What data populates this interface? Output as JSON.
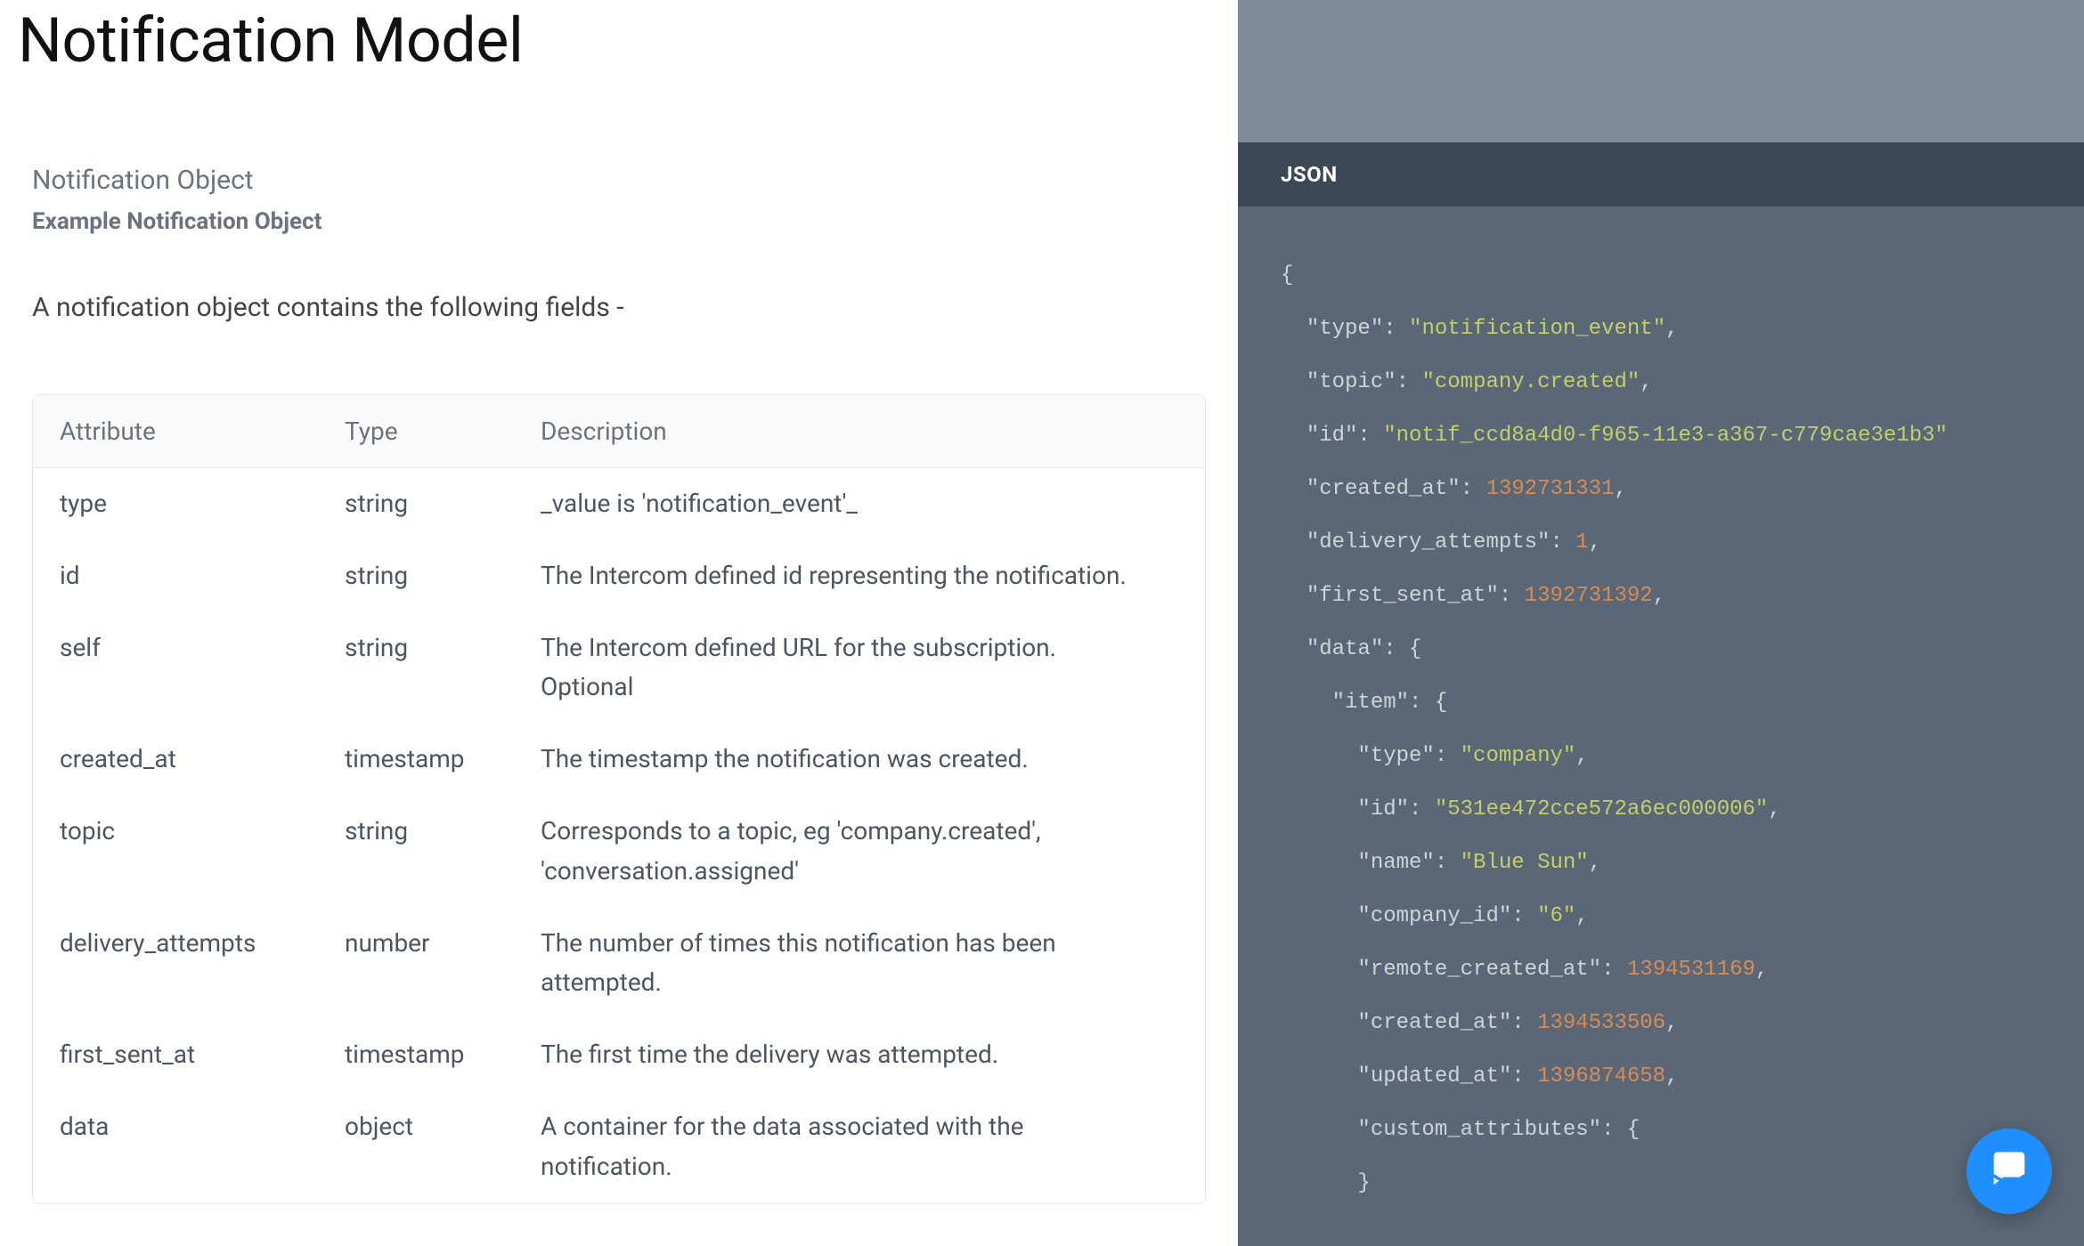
{
  "page": {
    "title": "Notification Model"
  },
  "section": {
    "heading": "Notification Object",
    "subheading": "Example Notification Object",
    "intro": "A notification object contains the following fields -"
  },
  "table": {
    "headers": {
      "attr": "Attribute",
      "type": "Type",
      "desc": "Description"
    },
    "rows": [
      {
        "attr": "type",
        "type": "string",
        "desc": "_value is 'notification_event'_"
      },
      {
        "attr": "id",
        "type": "string",
        "desc": "The Intercom defined id representing the notification."
      },
      {
        "attr": "self",
        "type": "string",
        "desc": "The Intercom defined URL for the subscription. Optional"
      },
      {
        "attr": "created_at",
        "type": "timestamp",
        "desc": "The timestamp the notification was created."
      },
      {
        "attr": "topic",
        "type": "string",
        "desc": "Corresponds to a topic, eg 'company.created', 'conversation.assigned'"
      },
      {
        "attr": "delivery_attempts",
        "type": "number",
        "desc": "The number of times this notification has been attempted."
      },
      {
        "attr": "first_sent_at",
        "type": "timestamp",
        "desc": "The first time the delivery was attempted."
      },
      {
        "attr": "data",
        "type": "object",
        "desc": "A container for the data associated with the notification."
      }
    ]
  },
  "code": {
    "tab_label": "JSON",
    "example": {
      "type": "notification_event",
      "topic": "company.created",
      "id": "notif_ccd8a4d0-f965-11e3-a367-c779cae3e1b3",
      "created_at": 1392731331,
      "delivery_attempts": 1,
      "first_sent_at": 1392731392,
      "data": {
        "item": {
          "type": "company",
          "id": "531ee472cce572a6ec000006",
          "name": "Blue Sun",
          "company_id": "6",
          "remote_created_at": 1394531169,
          "created_at": 1394533506,
          "updated_at": 1396874658,
          "custom_attributes": {}
        }
      }
    }
  }
}
